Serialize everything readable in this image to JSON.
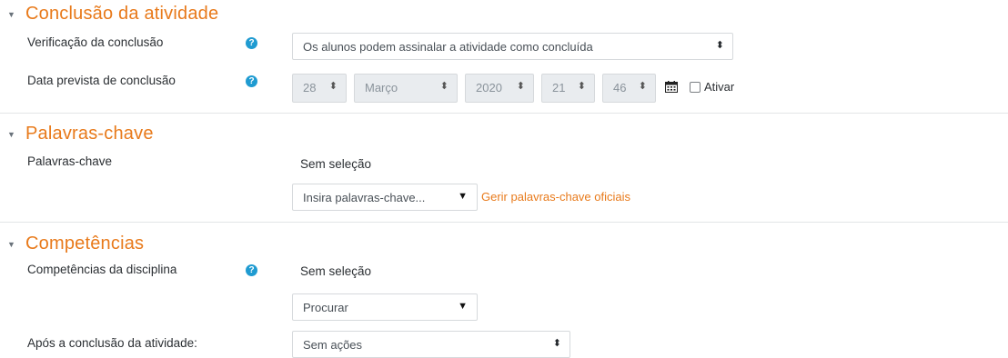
{
  "sections": {
    "conclusao": {
      "title": "Conclusão da atividade",
      "verificacao_label": "Verificação da conclusão",
      "verificacao_value": "Os alunos podem assinalar a atividade como concluída",
      "data_label": "Data prevista de conclusão",
      "date": {
        "day": "28",
        "month": "Março",
        "year": "2020",
        "hour": "21",
        "minute": "46"
      },
      "ativar_label": "Ativar"
    },
    "palavras": {
      "title": "Palavras-chave",
      "label": "Palavras-chave",
      "sem_selecao": "Sem seleção",
      "input_placeholder": "Insira palavras-chave...",
      "link": "Gerir palavras-chave oficiais"
    },
    "competencias": {
      "title": "Competências",
      "disciplina_label": "Competências da disciplina",
      "sem_selecao": "Sem seleção",
      "procurar": "Procurar",
      "apos_label": "Após a conclusão da atividade:",
      "apos_value": "Sem ações"
    }
  },
  "icons": {
    "help": "question-circle-icon",
    "calendar": "calendar-icon",
    "collapse": "caret-down-icon"
  },
  "colors": {
    "accent": "#e87a1b",
    "help": "#1f9bd1"
  }
}
